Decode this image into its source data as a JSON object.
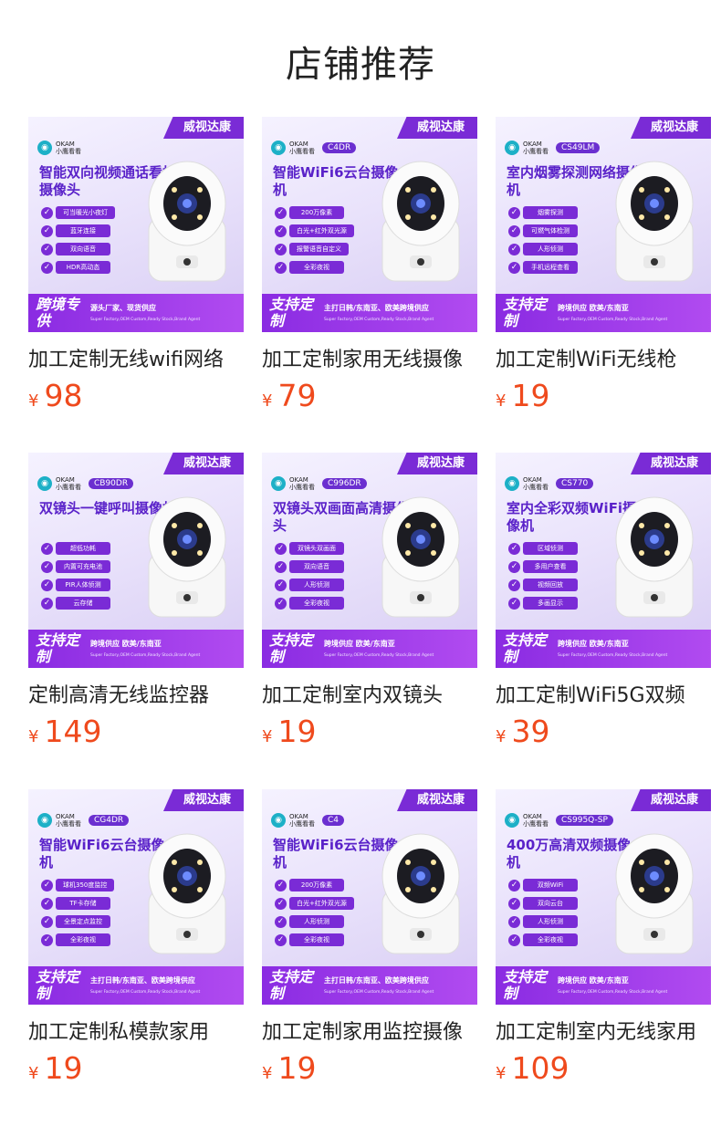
{
  "section_title": "店铺推荐",
  "colors": {
    "price": "#ef4a1d",
    "accent": "#7a2bd6"
  },
  "products": [
    {
      "badge": "威视达康",
      "brand": "OKAM",
      "brand_sub": "小鹰看看",
      "model": "",
      "headline": "智能双向视频通话看护摄像头",
      "features": [
        "可当暖光小夜灯",
        "蓝牙连接",
        "双向语音",
        "HDR高动态"
      ],
      "footer_big": "跨境专供",
      "footer_sub": "源头厂家、现货供应",
      "footer_tiny": "Super Factory,OEM Custom,Ready Stock,Brand Agent",
      "name": "加工定制无线wifi网络",
      "currency": "¥",
      "price": "98"
    },
    {
      "badge": "威视达康",
      "brand": "OKAM",
      "brand_sub": "小鹰看看",
      "model": "C4DR",
      "headline": "智能WiFi6云台摄像机",
      "features": [
        "200万像素",
        "白光+红外双光源",
        "报警语音自定义",
        "全彩夜视"
      ],
      "footer_big": "支持定制",
      "footer_sub": "主打日韩/东南亚、欧美跨境供应",
      "footer_tiny": "Super Factory,OEM Custom,Ready Stock,Brand Agent",
      "name": "加工定制家用无线摄像",
      "currency": "¥",
      "price": "79"
    },
    {
      "badge": "威视达康",
      "brand": "OKAM",
      "brand_sub": "小鹰看看",
      "model": "CS49LM",
      "headline": "室内烟雾探测网络摄像机",
      "features": [
        "烟雾探测",
        "可燃气体检测",
        "人形侦测",
        "手机远程查看"
      ],
      "footer_big": "支持定制",
      "footer_sub": "跨境供应 欧美/东南亚",
      "footer_tiny": "Super Factory,OEM Custom,Ready Stock,Brand Agent",
      "name": "加工定制WiFi无线枪",
      "currency": "¥",
      "price": "19"
    },
    {
      "badge": "威视达康",
      "brand": "OKAM",
      "brand_sub": "小鹰看看",
      "model": "CB90DR",
      "headline": "双镜头一键呼叫摄像机",
      "features": [
        "超低功耗",
        "内置可充电池",
        "PIR人体侦测",
        "云存储"
      ],
      "footer_big": "支持定制",
      "footer_sub": "跨境供应 欧美/东南亚",
      "footer_tiny": "Super Factory,OEM Custom,Ready Stock,Brand Agent",
      "name": "定制高清无线监控器",
      "currency": "¥",
      "price": "149"
    },
    {
      "badge": "威视达康",
      "brand": "OKAM",
      "brand_sub": "小鹰看看",
      "model": "C996DR",
      "headline": "双镜头双画面高清摄像头",
      "features": [
        "双镜头双画面",
        "双向语音",
        "人形侦测",
        "全彩夜视"
      ],
      "footer_big": "支持定制",
      "footer_sub": "跨境供应 欧美/东南亚",
      "footer_tiny": "Super Factory,OEM Custom,Ready Stock,Brand Agent",
      "name": "加工定制室内双镜头",
      "currency": "¥",
      "price": "19"
    },
    {
      "badge": "威视达康",
      "brand": "OKAM",
      "brand_sub": "小鹰看看",
      "model": "CS770",
      "headline": "室内全彩双频WiFi摄像机",
      "features": [
        "区域侦测",
        "多用户查看",
        "视频回放",
        "多画显示"
      ],
      "footer_big": "支持定制",
      "footer_sub": "跨境供应 欧美/东南亚",
      "footer_tiny": "Super Factory,OEM Custom,Ready Stock,Brand Agent",
      "name": "加工定制WiFi5G双频",
      "currency": "¥",
      "price": "39"
    },
    {
      "badge": "威视达康",
      "brand": "OKAM",
      "brand_sub": "小鹰看看",
      "model": "CG4DR",
      "headline": "智能WiFi6云台摄像机",
      "features": [
        "球机350度监控",
        "TF卡存储",
        "全景定点监控",
        "全彩夜视"
      ],
      "footer_big": "支持定制",
      "footer_sub": "主打日韩/东南亚、欧美跨境供应",
      "footer_tiny": "Super Factory,OEM Custom,Ready Stock,Brand Agent",
      "name": "加工定制私模款家用",
      "currency": "¥",
      "price": "19"
    },
    {
      "badge": "威视达康",
      "brand": "OKAM",
      "brand_sub": "小鹰看看",
      "model": "C4",
      "headline": "智能WiFi6云台摄像机",
      "features": [
        "200万像素",
        "白光+红外双光源",
        "人形侦测",
        "全彩夜视"
      ],
      "footer_big": "支持定制",
      "footer_sub": "主打日韩/东南亚、欧美跨境供应",
      "footer_tiny": "Super Factory,OEM Custom,Ready Stock,Brand Agent",
      "name": "加工定制家用监控摄像",
      "currency": "¥",
      "price": "19"
    },
    {
      "badge": "威视达康",
      "brand": "OKAM",
      "brand_sub": "小鹰看看",
      "model": "CS995Q-SP",
      "headline": "400万高清双频摄像机",
      "features": [
        "双频WiFi",
        "双向云台",
        "人形侦测",
        "全彩夜视"
      ],
      "footer_big": "支持定制",
      "footer_sub": "跨境供应 欧美/东南亚",
      "footer_tiny": "Super Factory,OEM Custom,Ready Stock,Brand Agent",
      "name": "加工定制室内无线家用",
      "currency": "¥",
      "price": "109"
    }
  ]
}
